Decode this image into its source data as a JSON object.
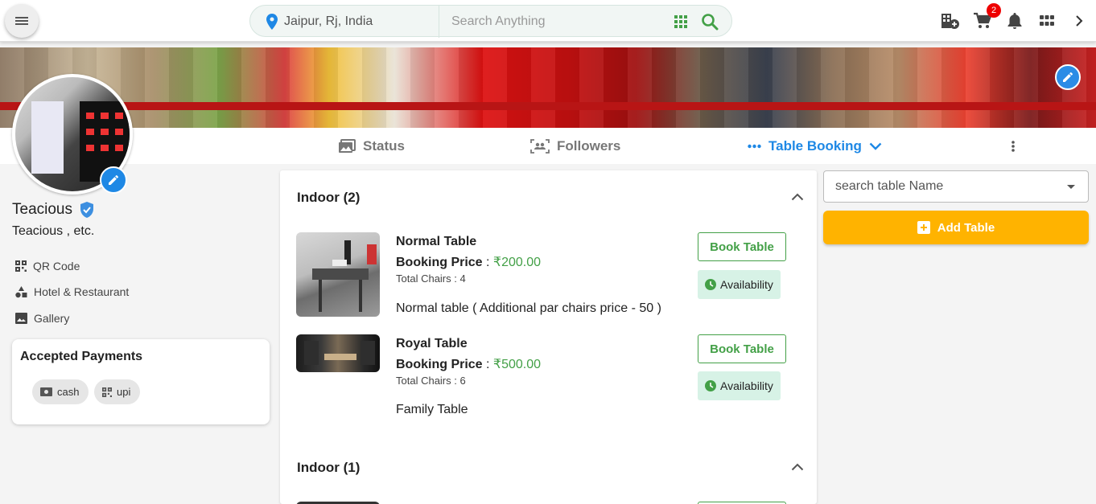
{
  "header": {
    "location": "Jaipur, Rj, India",
    "search_placeholder": "Search Anything",
    "cart_count": "2"
  },
  "tabs": [
    {
      "label": "Status",
      "icon": "status-icon"
    },
    {
      "label": "Followers",
      "icon": "followers-icon"
    },
    {
      "label": "Table Booking",
      "icon": "dots-icon",
      "active": true
    }
  ],
  "profile": {
    "name": "Teacious",
    "subtitle": "Teacious , etc.",
    "links": [
      {
        "label": "QR Code",
        "icon": "qr-icon"
      },
      {
        "label": "Hotel & Restaurant",
        "icon": "category-icon"
      },
      {
        "label": "Gallery",
        "icon": "image-icon"
      }
    ]
  },
  "payments": {
    "title": "Accepted Payments",
    "methods": [
      "cash",
      "upi"
    ]
  },
  "sections": [
    {
      "title": "Indoor (2)",
      "tables": [
        {
          "name": "Normal Table",
          "price_label": "Booking Price",
          "price": "₹200.00",
          "chairs": "Total Chairs : 4",
          "description": "Normal table ( Additional par chairs price - 50 )",
          "book_label": "Book Table",
          "availability_label": "Availability"
        },
        {
          "name": "Royal Table",
          "price_label": "Booking Price",
          "price": "₹500.00",
          "chairs": "Total Chairs : 6",
          "description": "Family Table",
          "book_label": "Book Table",
          "availability_label": "Availability"
        }
      ]
    },
    {
      "title": "Indoor (1)",
      "tables": []
    }
  ],
  "right_panel": {
    "search_placeholder": "search table Name",
    "add_label": "Add Table"
  },
  "colors": {
    "accent": "#1e88e5",
    "green": "#43a047",
    "add_button": "#ffb300",
    "availability_bg": "#d7f2e6"
  }
}
